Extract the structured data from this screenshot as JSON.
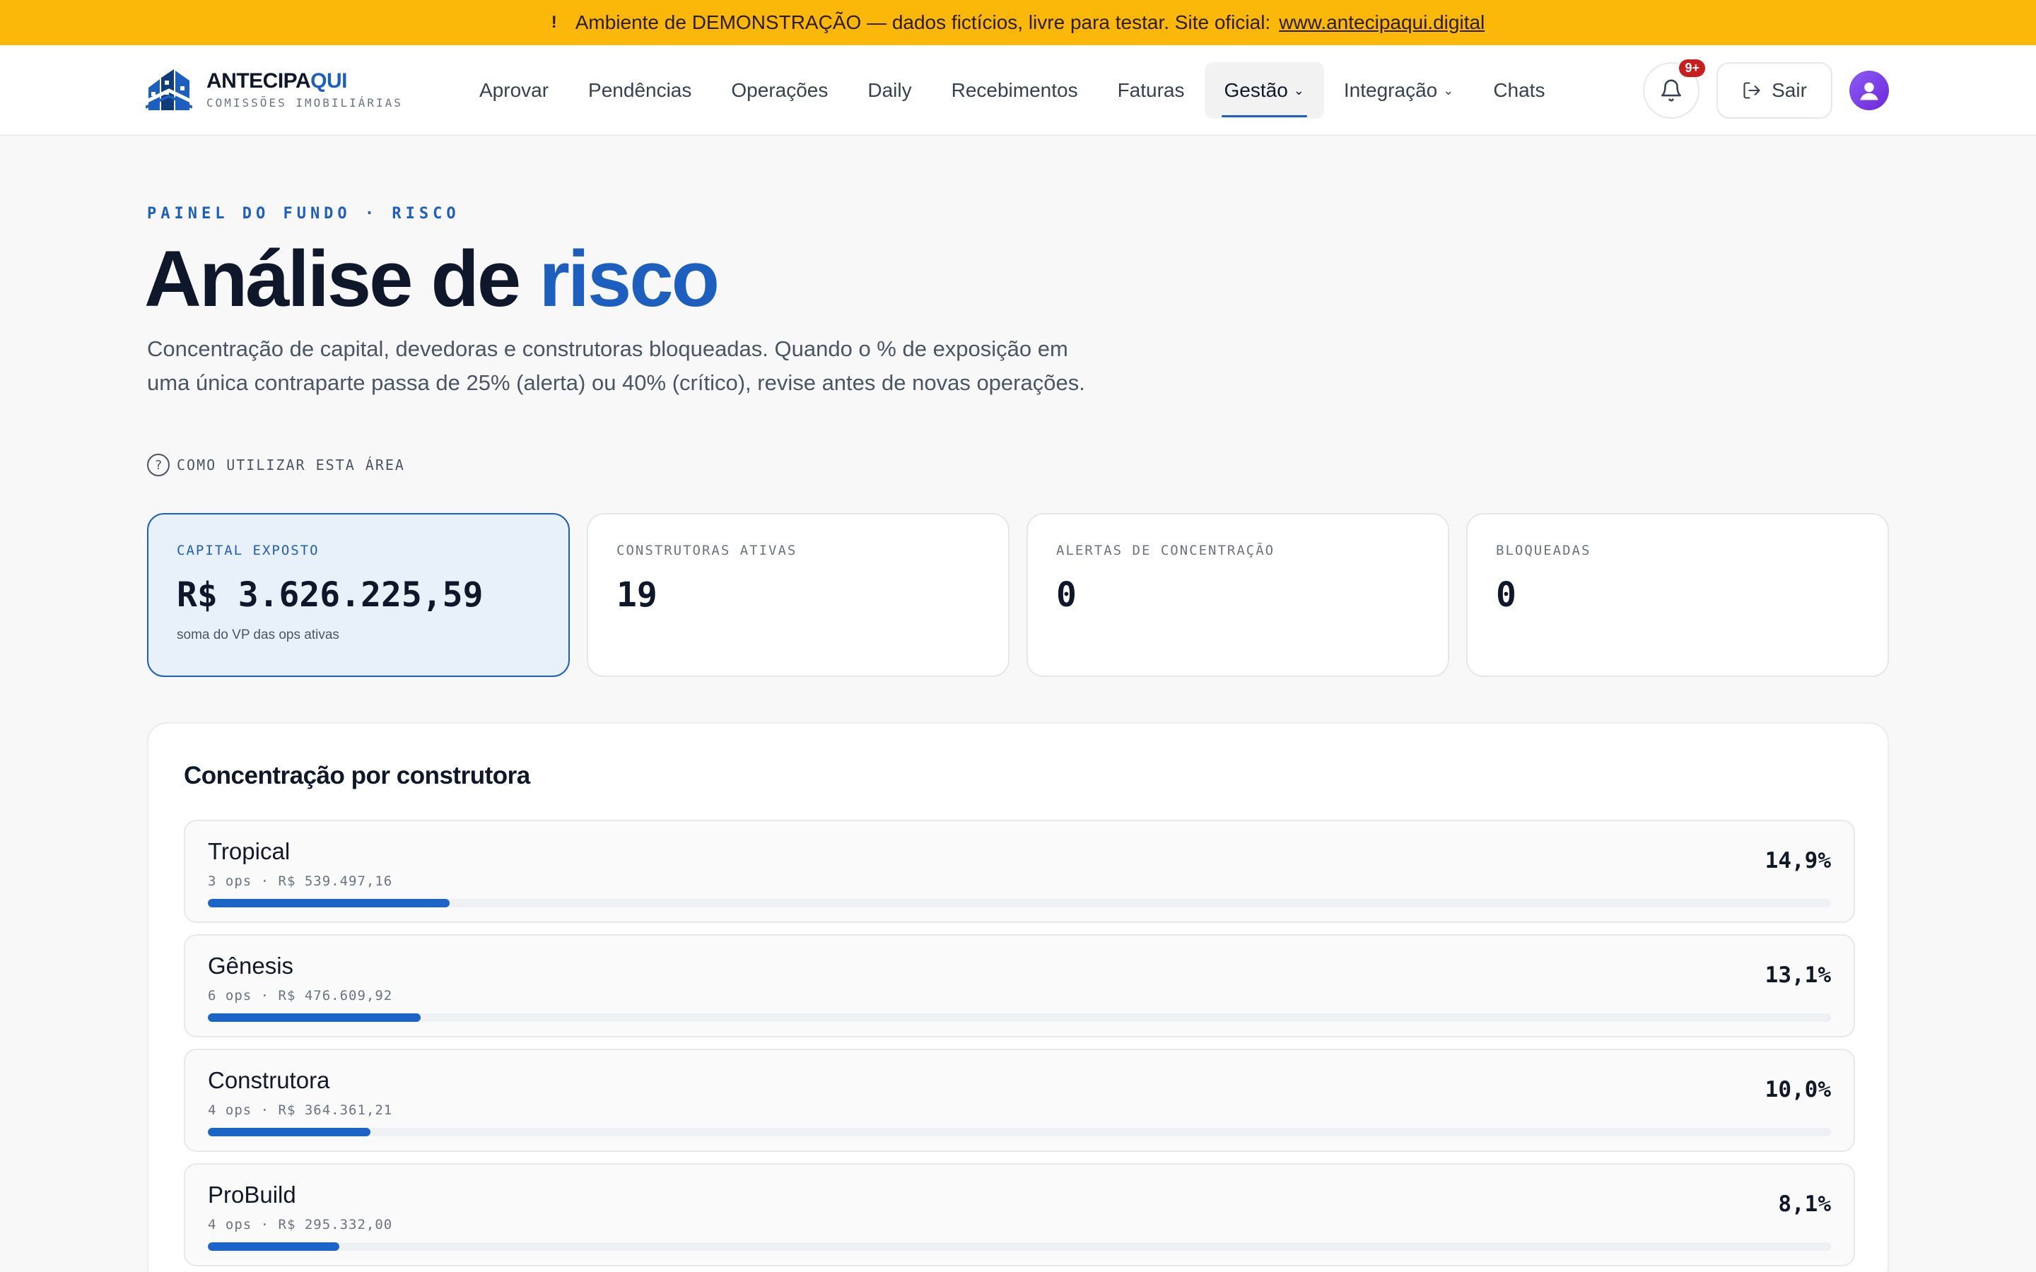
{
  "banner": {
    "icon": "warning-icon",
    "text": "Ambiente de DEMONSTRAÇÃO — dados fictícios, livre para testar. Site oficial:",
    "link": "www.antecipaqui.digital"
  },
  "brand": {
    "name_part1": "ANTECIPA",
    "name_part2": "QUI",
    "subtitle": "COMISSÕES IMOBILIÁRIAS"
  },
  "nav": {
    "items": [
      {
        "label": "Aprovar"
      },
      {
        "label": "Pendências"
      },
      {
        "label": "Operações"
      },
      {
        "label": "Daily"
      },
      {
        "label": "Recebimentos"
      },
      {
        "label": "Faturas"
      },
      {
        "label": "Gestão",
        "active": true,
        "dropdown": true
      },
      {
        "label": "Integração",
        "dropdown": true
      },
      {
        "label": "Chats"
      }
    ],
    "notifications_badge": "9+",
    "logout_label": "Sair"
  },
  "page": {
    "eyebrow": "PAINEL DO FUNDO · RISCO",
    "title_main": "Análise de ",
    "title_accent": "risco",
    "description": "Concentração de capital, devedoras e construtoras bloqueadas. Quando o % de exposição em uma única contraparte passa de 25% (alerta) ou 40% (crítico), revise antes de novas operações.",
    "help_label": "COMO UTILIZAR ESTA ÁREA"
  },
  "stats": [
    {
      "label": "CAPITAL EXPOSTO",
      "value": "R$ 3.626.225,59",
      "note": "soma do VP das ops ativas"
    },
    {
      "label": "CONSTRUTORAS ATIVAS",
      "value": "19",
      "note": ""
    },
    {
      "label": "ALERTAS DE CONCENTRAÇÃO",
      "value": "0",
      "note": ""
    },
    {
      "label": "BLOQUEADAS",
      "value": "0",
      "note": ""
    }
  ],
  "concentration": {
    "title": "Concentração por construtora",
    "rows": [
      {
        "name": "Tropical",
        "meta": "3 ops · R$ 539.497,16",
        "pct": "14,9%",
        "share": 0.149
      },
      {
        "name": "Gênesis",
        "meta": "6 ops · R$ 476.609,92",
        "pct": "13,1%",
        "share": 0.131
      },
      {
        "name": "Construtora",
        "meta": "4 ops · R$ 364.361,21",
        "pct": "10,0%",
        "share": 0.1
      },
      {
        "name": "ProBuild",
        "meta": "4 ops · R$ 295.332,00",
        "pct": "8,1%",
        "share": 0.081
      }
    ]
  },
  "colors": {
    "banner": "#fbb809",
    "accent": "#1d5fbf",
    "badge": "#c81e1e",
    "avatar": "#7c3aed"
  }
}
